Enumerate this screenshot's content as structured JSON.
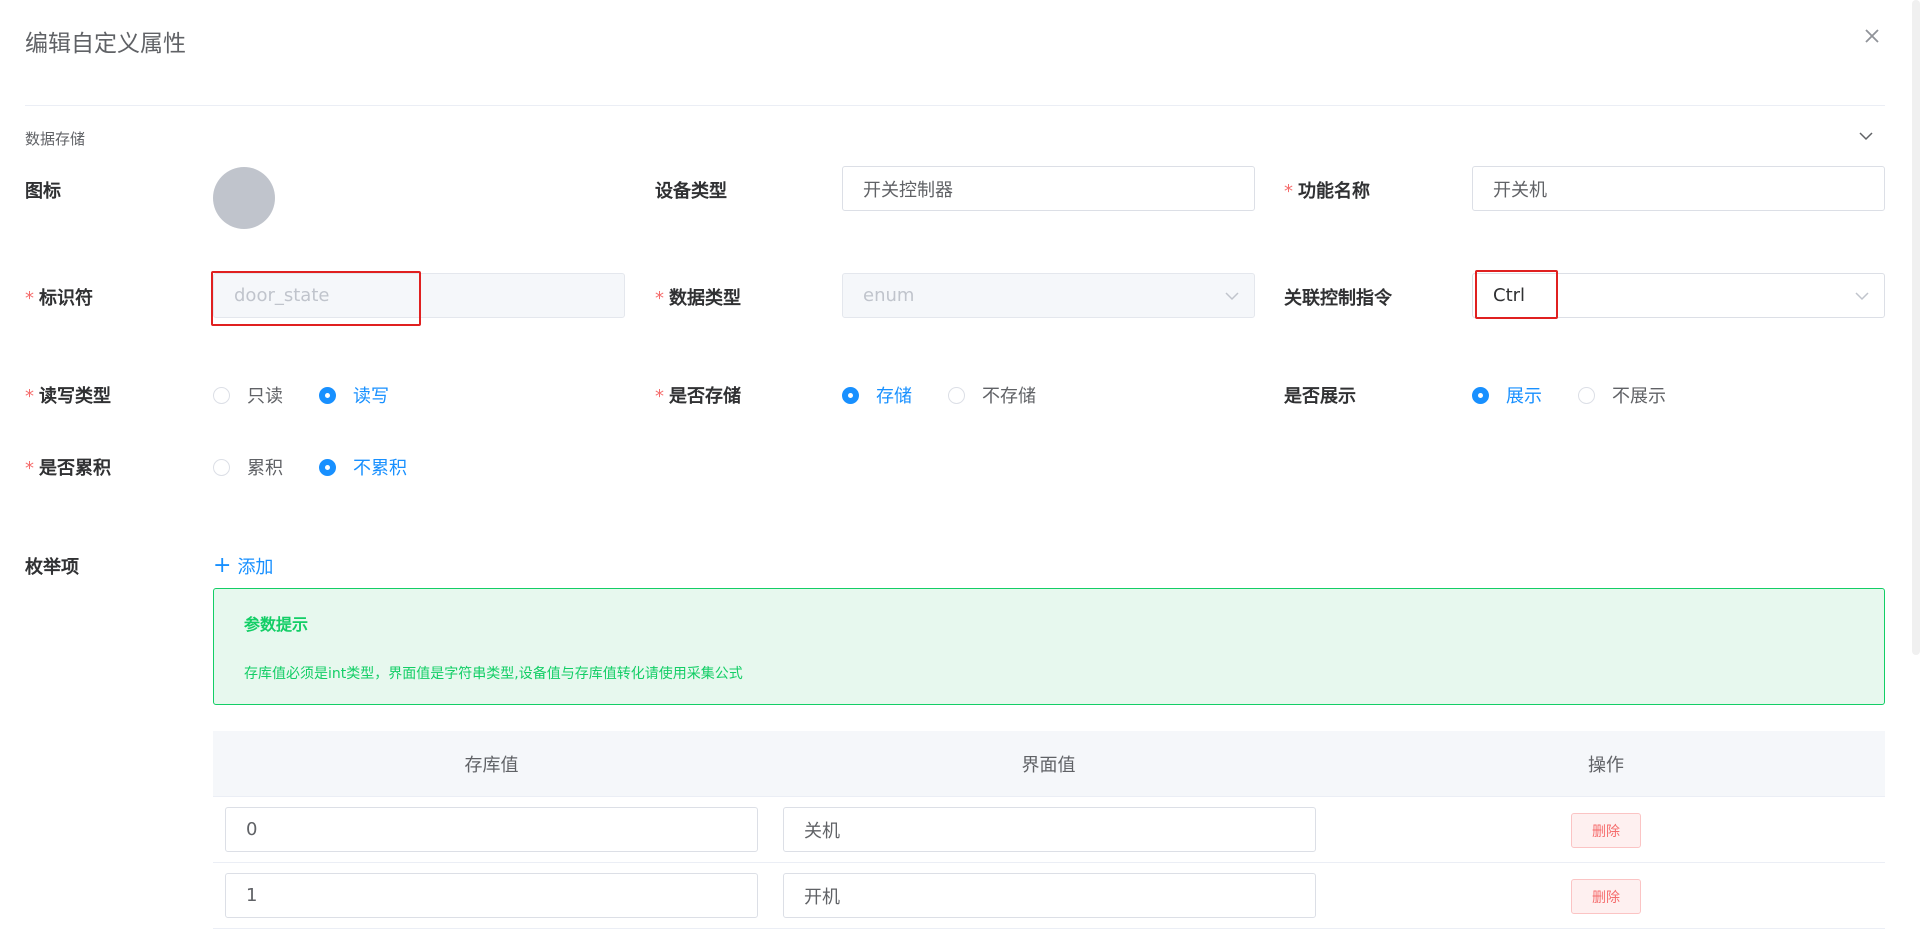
{
  "dialog": {
    "title": "编辑自定义属性",
    "section_title": "数据存储"
  },
  "form": {
    "icon_label": "图标",
    "device_type_label": "设备类型",
    "device_type_value": "开关控制器",
    "function_name_label": "功能名称",
    "function_name_value": "开关机",
    "identifier_label": "标识符",
    "identifier_placeholder": "door_state",
    "data_type_label": "数据类型",
    "data_type_value": "enum",
    "linked_command_label": "关联控制指令",
    "linked_command_value": "Ctrl",
    "rw_type_label": "读写类型",
    "rw_options": [
      "只读",
      "读写"
    ],
    "rw_selected": "读写",
    "store_label": "是否存储",
    "store_options": [
      "存储",
      "不存储"
    ],
    "store_selected": "存储",
    "display_label": "是否展示",
    "display_options": [
      "展示",
      "不展示"
    ],
    "display_selected": "展示",
    "accumulate_label": "是否累积",
    "accumulate_options": [
      "累积",
      "不累积"
    ],
    "accumulate_selected": "不累积",
    "enum_label": "枚举项",
    "add_label": "添加"
  },
  "alert": {
    "title": "参数提示",
    "description": "存库值必须是int类型，界面值是字符串类型,设备值与存库值转化请使用采集公式"
  },
  "table": {
    "headers": [
      "存库值",
      "界面值",
      "操作"
    ],
    "rows": [
      {
        "store_value": "0",
        "display_value": "关机",
        "action": "删除"
      },
      {
        "store_value": "1",
        "display_value": "开机",
        "action": "删除"
      }
    ]
  },
  "colors": {
    "primary": "#1890ff",
    "required": "#f56c6c",
    "success": "#13ce66",
    "highlight": "#e02020"
  },
  "icons": [
    "close-icon",
    "chevron-down-icon",
    "plus-icon"
  ]
}
